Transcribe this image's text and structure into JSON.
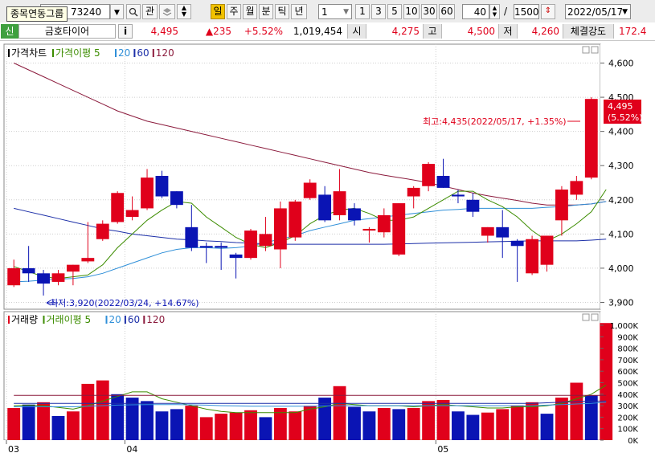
{
  "toolbar": {
    "tooltip": "종목연동그룹",
    "code": "73240",
    "btn_kwan": "관",
    "periods": [
      "일",
      "주",
      "월",
      "분",
      "틱",
      "년"
    ],
    "active_period": "일",
    "unit_select": "1",
    "intervals": [
      "1",
      "3",
      "5",
      "10",
      "30",
      "60"
    ],
    "count_value": "40",
    "slash": "/",
    "total_value": "1500",
    "date_value": "2022/05/17"
  },
  "quote": {
    "sin_label": "신",
    "name": "금호타이어",
    "info_btn": "i",
    "price": "4,495",
    "change": "▲235",
    "change_pct": "+5.52%",
    "volume": "1,019,454",
    "open_label": "시",
    "open": "4,275",
    "high_label": "고",
    "high": "4,500",
    "low_label": "저",
    "low": "4,260",
    "strength_label": "체결강도",
    "strength": "172.4"
  },
  "price_panel": {
    "legend": [
      {
        "text": "가격차트",
        "color": "#000000"
      },
      {
        "text": "가격이평 5",
        "color": "#3c8c00"
      },
      {
        "text": "20",
        "color": "#2f8fd8"
      },
      {
        "text": "60",
        "color": "#1c2fa8"
      },
      {
        "text": "120",
        "color": "#8b1a3c"
      }
    ],
    "current_price_label": "4,495",
    "current_pct_label": "(5.52%)",
    "high_annotation": "최고:4,435(2022/05/17, +1.35%)",
    "low_annotation": "최저:3,920(2022/03/24, +14.67%)"
  },
  "volume_panel": {
    "legend": [
      {
        "text": "거래량",
        "color": "#000000"
      },
      {
        "text": "거래이평 5",
        "color": "#3c8c00"
      },
      {
        "text": "20",
        "color": "#2f8fd8"
      },
      {
        "text": "60",
        "color": "#1c2fa8"
      },
      {
        "text": "120",
        "color": "#8b1a3c"
      }
    ]
  },
  "chart_data": [
    {
      "type": "candlestick",
      "title": "가격차트",
      "y_ticks": [
        3900,
        4000,
        4100,
        4200,
        4300,
        4400,
        4500,
        4600
      ],
      "y_tick_labels": [
        "3,900",
        "4,000",
        "4,100",
        "4,200",
        "4,300",
        "4,400",
        "4,500",
        "4,600"
      ],
      "ylim": [
        3880,
        4620
      ],
      "x_labels": [
        {
          "index": 0,
          "text": "03"
        },
        {
          "index": 8,
          "text": "04"
        },
        {
          "index": 29,
          "text": "05"
        }
      ],
      "candles": [
        {
          "o": 3950,
          "h": 4025,
          "l": 3945,
          "c": 4000
        },
        {
          "o": 4000,
          "h": 4065,
          "l": 3960,
          "c": 3985
        },
        {
          "o": 3985,
          "h": 3995,
          "l": 3920,
          "c": 3955
        },
        {
          "o": 3960,
          "h": 3995,
          "l": 3950,
          "c": 3985
        },
        {
          "o": 3990,
          "h": 4010,
          "l": 3950,
          "c": 4010
        },
        {
          "o": 4020,
          "h": 4135,
          "l": 4015,
          "c": 4030
        },
        {
          "o": 4085,
          "h": 4140,
          "l": 4080,
          "c": 4130
        },
        {
          "o": 4135,
          "h": 4225,
          "l": 4130,
          "c": 4220
        },
        {
          "o": 4150,
          "h": 4210,
          "l": 4140,
          "c": 4170
        },
        {
          "o": 4175,
          "h": 4290,
          "l": 4170,
          "c": 4265
        },
        {
          "o": 4270,
          "h": 4285,
          "l": 4205,
          "c": 4210
        },
        {
          "o": 4225,
          "h": 4225,
          "l": 4175,
          "c": 4185
        },
        {
          "o": 4120,
          "h": 4185,
          "l": 4050,
          "c": 4060
        },
        {
          "o": 4065,
          "h": 4075,
          "l": 4015,
          "c": 4060
        },
        {
          "o": 4065,
          "h": 4075,
          "l": 3995,
          "c": 4060
        },
        {
          "o": 4040,
          "h": 4045,
          "l": 3970,
          "c": 4030
        },
        {
          "o": 4030,
          "h": 4115,
          "l": 4025,
          "c": 4110
        },
        {
          "o": 4065,
          "h": 4150,
          "l": 4050,
          "c": 4100
        },
        {
          "o": 4055,
          "h": 4195,
          "l": 4000,
          "c": 4175
        },
        {
          "o": 4090,
          "h": 4200,
          "l": 4080,
          "c": 4195
        },
        {
          "o": 4205,
          "h": 4260,
          "l": 4200,
          "c": 4250
        },
        {
          "o": 4215,
          "h": 4240,
          "l": 4135,
          "c": 4140
        },
        {
          "o": 4155,
          "h": 4290,
          "l": 4140,
          "c": 4225
        },
        {
          "o": 4175,
          "h": 4190,
          "l": 4125,
          "c": 4140
        },
        {
          "o": 4110,
          "h": 4120,
          "l": 4075,
          "c": 4115
        },
        {
          "o": 4105,
          "h": 4175,
          "l": 4090,
          "c": 4155
        },
        {
          "o": 4040,
          "h": 4190,
          "l": 4035,
          "c": 4190
        },
        {
          "o": 4210,
          "h": 4240,
          "l": 4175,
          "c": 4235
        },
        {
          "o": 4240,
          "h": 4310,
          "l": 4225,
          "c": 4305
        },
        {
          "o": 4270,
          "h": 4320,
          "l": 4235,
          "c": 4235
        },
        {
          "o": 4215,
          "h": 4230,
          "l": 4190,
          "c": 4210
        },
        {
          "o": 4200,
          "h": 4220,
          "l": 4150,
          "c": 4165
        },
        {
          "o": 4095,
          "h": 4120,
          "l": 4075,
          "c": 4120
        },
        {
          "o": 4120,
          "h": 4170,
          "l": 4030,
          "c": 4090
        },
        {
          "o": 4080,
          "h": 4085,
          "l": 3960,
          "c": 4065
        },
        {
          "o": 3985,
          "h": 4095,
          "l": 3980,
          "c": 4085
        },
        {
          "o": 4010,
          "h": 4095,
          "l": 3990,
          "c": 4095
        },
        {
          "o": 4140,
          "h": 4240,
          "l": 4095,
          "c": 4230
        },
        {
          "o": 4215,
          "h": 4270,
          "l": 4200,
          "c": 4255
        },
        {
          "o": 4265,
          "h": 4500,
          "l": 4260,
          "c": 4495
        }
      ],
      "ma5": [
        4005,
        3990,
        3975,
        3970,
        3975,
        3980,
        4010,
        4060,
        4100,
        4140,
        4170,
        4195,
        4190,
        4150,
        4120,
        4090,
        4070,
        4060,
        4075,
        4095,
        4130,
        4155,
        4170,
        4175,
        4160,
        4140,
        4140,
        4150,
        4175,
        4200,
        4225,
        4225,
        4200,
        4180,
        4150,
        4110,
        4080,
        4100,
        4130,
        4165,
        4230
      ],
      "ma20": [
        3960,
        3962,
        3965,
        3968,
        3970,
        3975,
        3985,
        4000,
        4015,
        4030,
        4045,
        4055,
        4060,
        4060,
        4058,
        4060,
        4065,
        4075,
        4085,
        4095,
        4110,
        4120,
        4130,
        4140,
        4145,
        4150,
        4155,
        4160,
        4165,
        4170,
        4172,
        4175,
        4175,
        4175,
        4175,
        4175,
        4178,
        4180,
        4185,
        4188,
        4195
      ],
      "ma60": [
        4175,
        4165,
        4155,
        4145,
        4135,
        4125,
        4115,
        4108,
        4100,
        4095,
        4090,
        4085,
        4083,
        4080,
        4078,
        4075,
        4073,
        4071,
        4070,
        4070,
        4070,
        4070,
        4070,
        4070,
        4070,
        4070,
        4071,
        4072,
        4073,
        4074,
        4075,
        4076,
        4077,
        4078,
        4079,
        4080,
        4080,
        4080,
        4080,
        4082,
        4085
      ],
      "ma120": [
        4600,
        4580,
        4560,
        4540,
        4520,
        4500,
        4480,
        4460,
        4445,
        4430,
        4420,
        4410,
        4400,
        4390,
        4380,
        4370,
        4360,
        4350,
        4340,
        4330,
        4320,
        4310,
        4300,
        4290,
        4280,
        4272,
        4265,
        4258,
        4250,
        4240,
        4230,
        4220,
        4212,
        4205,
        4198,
        4190,
        4185,
        4185,
        4185,
        4188,
        4195
      ]
    },
    {
      "type": "bar",
      "title": "거래량",
      "y_ticks": [
        0,
        100000,
        200000,
        300000,
        400000,
        500000,
        600000,
        700000,
        800000,
        900000,
        1000000
      ],
      "y_tick_labels": [
        "0K",
        "100K",
        "200K",
        "300K",
        "400K",
        "500K",
        "600K",
        "700K",
        "800K",
        "900K",
        "1,000K"
      ],
      "ylim": [
        0,
        1000000
      ],
      "values": [
        280000,
        310000,
        330000,
        210000,
        250000,
        490000,
        520000,
        400000,
        370000,
        340000,
        250000,
        270000,
        300000,
        200000,
        230000,
        240000,
        260000,
        200000,
        280000,
        250000,
        300000,
        370000,
        470000,
        290000,
        250000,
        280000,
        270000,
        280000,
        340000,
        350000,
        250000,
        220000,
        240000,
        270000,
        300000,
        330000,
        230000,
        370000,
        500000,
        390000,
        1019454
      ],
      "up": [
        true,
        false,
        true,
        false,
        true,
        true,
        true,
        false,
        false,
        false,
        false,
        false,
        true,
        true,
        true,
        true,
        true,
        false,
        true,
        true,
        true,
        false,
        true,
        false,
        false,
        true,
        false,
        true,
        true,
        true,
        false,
        false,
        true,
        true,
        true,
        true,
        false,
        true,
        true,
        false,
        true
      ],
      "ma5": [
        300000,
        305000,
        300000,
        285000,
        270000,
        300000,
        340000,
        380000,
        420000,
        420000,
        360000,
        330000,
        300000,
        270000,
        250000,
        240000,
        240000,
        240000,
        240000,
        240000,
        270000,
        290000,
        320000,
        310000,
        300000,
        300000,
        300000,
        290000,
        300000,
        310000,
        300000,
        290000,
        280000,
        280000,
        290000,
        290000,
        300000,
        320000,
        360000,
        400000,
        480000
      ],
      "ma20": [
        290000,
        290000,
        290000,
        290000,
        290000,
        295000,
        300000,
        305000,
        308000,
        310000,
        310000,
        310000,
        308000,
        305000,
        300000,
        298000,
        296000,
        295000,
        295000,
        295000,
        296000,
        298000,
        300000,
        300000,
        300000,
        300000,
        300000,
        300000,
        300000,
        300000,
        300000,
        300000,
        300000,
        300000,
        300000,
        300000,
        305000,
        310000,
        315000,
        320000,
        330000
      ],
      "ma60": [
        320000,
        320000,
        320000,
        320000,
        320000,
        320000,
        320000,
        320000,
        320000,
        320000,
        320000,
        320000,
        320000,
        320000,
        320000,
        320000,
        320000,
        320000,
        320000,
        320000,
        320000,
        320000,
        320000,
        320000,
        320000,
        320000,
        320000,
        320000,
        320000,
        320000,
        320000,
        320000,
        320000,
        320000,
        320000,
        320000,
        325000,
        330000,
        335000,
        340000,
        340000
      ],
      "ma120": [
        390000,
        390000,
        390000,
        390000,
        390000,
        390000,
        390000,
        390000,
        390000,
        390000,
        390000,
        390000,
        390000,
        390000,
        390000,
        390000,
        390000,
        390000,
        390000,
        390000,
        390000,
        390000,
        390000,
        390000,
        390000,
        390000,
        390000,
        390000,
        390000,
        390000,
        390000,
        390000,
        390000,
        390000,
        390000,
        390000,
        390000,
        390000,
        390000,
        390000,
        390000
      ]
    }
  ],
  "colors": {
    "up": "#e0001b",
    "down": "#0a14b4",
    "ma5": "#3c8c00",
    "ma20": "#2f8fd8",
    "ma60": "#1c2fa8",
    "ma120": "#8b1a3c",
    "grid": "#cfcfcf",
    "active_period_bg": "#f2c200"
  }
}
